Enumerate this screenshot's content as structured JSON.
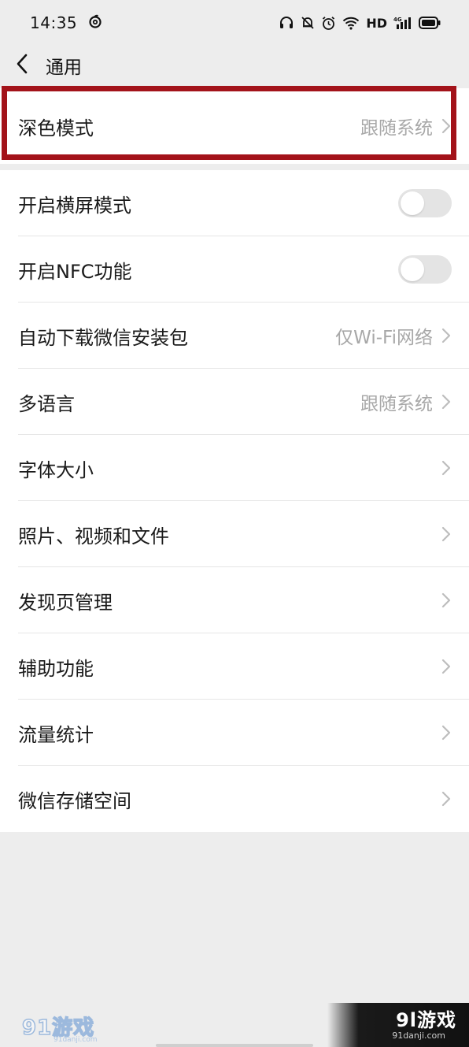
{
  "status_bar": {
    "time": "14:35",
    "network_label": "HD",
    "icons": [
      "netease-music-icon",
      "headphones-icon",
      "mute-bell-icon",
      "alarm-icon",
      "wifi-icon",
      "signal-4g-icon",
      "battery-icon"
    ]
  },
  "nav": {
    "title": "通用",
    "back_icon": "chevron-left-icon"
  },
  "settings": {
    "dark_mode": {
      "label": "深色模式",
      "value": "跟随系统"
    },
    "landscape": {
      "label": "开启横屏模式",
      "enabled": false
    },
    "nfc": {
      "label": "开启NFC功能",
      "enabled": false
    },
    "auto_download": {
      "label": "自动下载微信安装包",
      "value": "仅Wi-Fi网络"
    },
    "language": {
      "label": "多语言",
      "value": "跟随系统"
    },
    "font_size": {
      "label": "字体大小"
    },
    "media": {
      "label": "照片、视频和文件"
    },
    "discover": {
      "label": "发现页管理"
    },
    "accessibility": {
      "label": "辅助功能"
    },
    "traffic": {
      "label": "流量统计"
    },
    "storage": {
      "label": "微信存储空间"
    }
  },
  "watermarks": {
    "left_logo": "91游戏",
    "left_domain": "91danji.com",
    "right_logo": "9l游戏",
    "right_domain": "91danji.com"
  },
  "colors": {
    "page_background": "#ededed",
    "list_background": "#ffffff",
    "highlight_border": "#a3131a",
    "value_text": "#a8a8a8",
    "toggle_off": "#e4e4e4"
  }
}
